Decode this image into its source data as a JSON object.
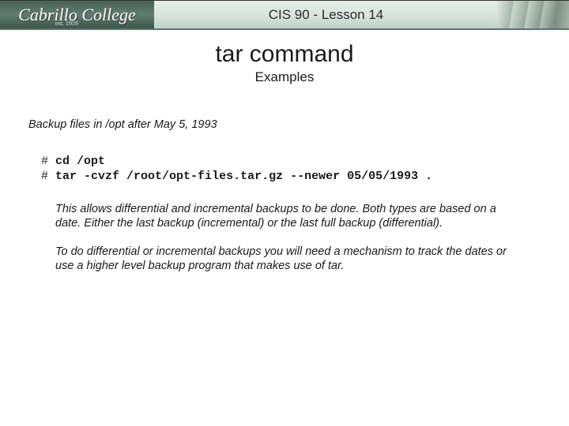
{
  "header": {
    "logo_main": "Cabrillo College",
    "logo_est": "est. 1959",
    "title": "CIS 90 - Lesson 14"
  },
  "title": "tar command",
  "subtitle": "Examples",
  "description": "Backup files in /opt after May 5, 1993",
  "commands": {
    "prompt": "#",
    "line1": "cd /opt",
    "line2": "tar -cvzf /root/opt-files.tar.gz --newer 05/05/1993 ."
  },
  "paragraphs": {
    "p1": "This allows differential and incremental backups to be done.  Both types are based on a date.  Either the last backup (incremental) or the last full backup (differential).",
    "p2": "To do differential or incremental backups you will need a mechanism to track the dates or use a higher level backup program that makes use of tar."
  }
}
